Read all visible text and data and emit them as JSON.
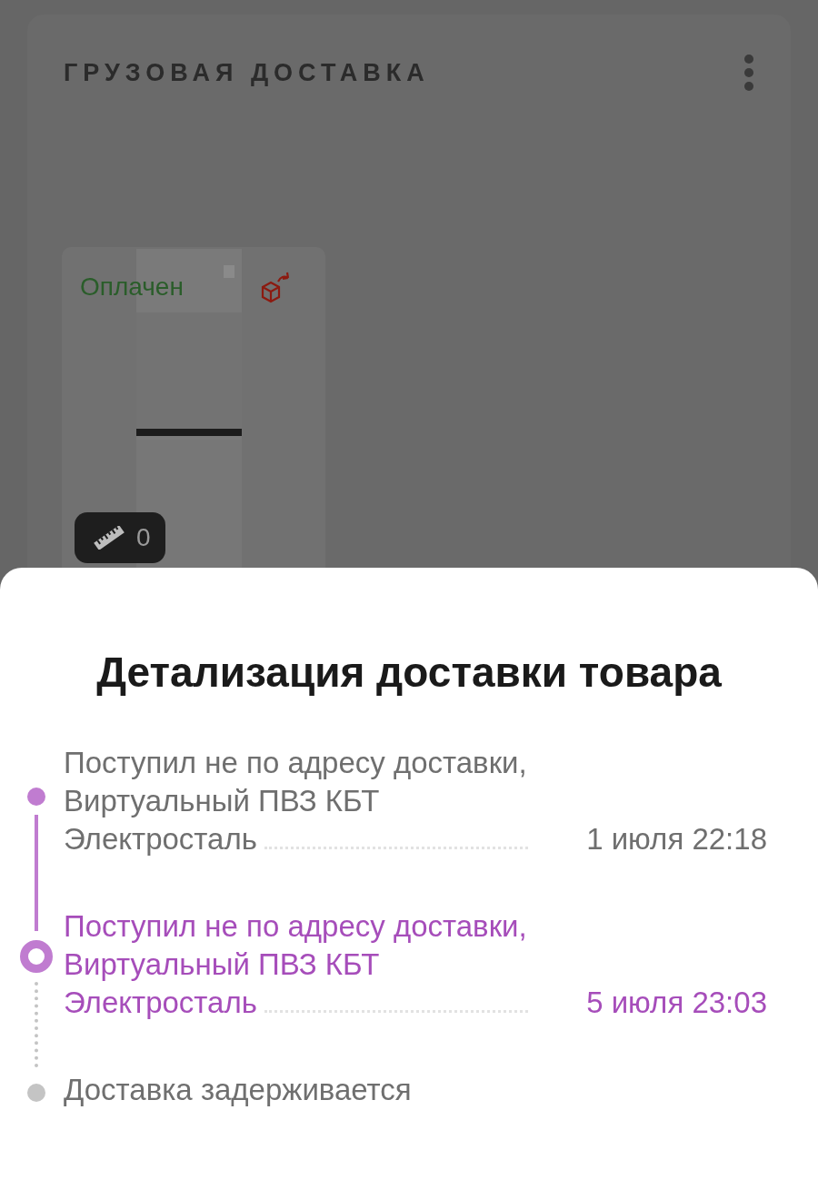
{
  "card": {
    "title": "ГРУЗОВАЯ ДОСТАВКА",
    "item": {
      "kind": "picture",
      "status": "Оплачен",
      "measure_count": "0"
    }
  },
  "sheet": {
    "title": "Детализация доставки товара",
    "steps": [
      {
        "kind": "done",
        "text": "Поступил не по адресу доставки, Виртуальный ПВЗ КБТ Электросталь",
        "date": "1 июля 22:18"
      },
      {
        "kind": "current",
        "text": "Поступил не по адресу доставки, Виртуальный ПВЗ КБТ Электросталь",
        "date": "5 июля 23:03"
      },
      {
        "kind": "pending",
        "text": "Доставка задерживается"
      }
    ]
  }
}
